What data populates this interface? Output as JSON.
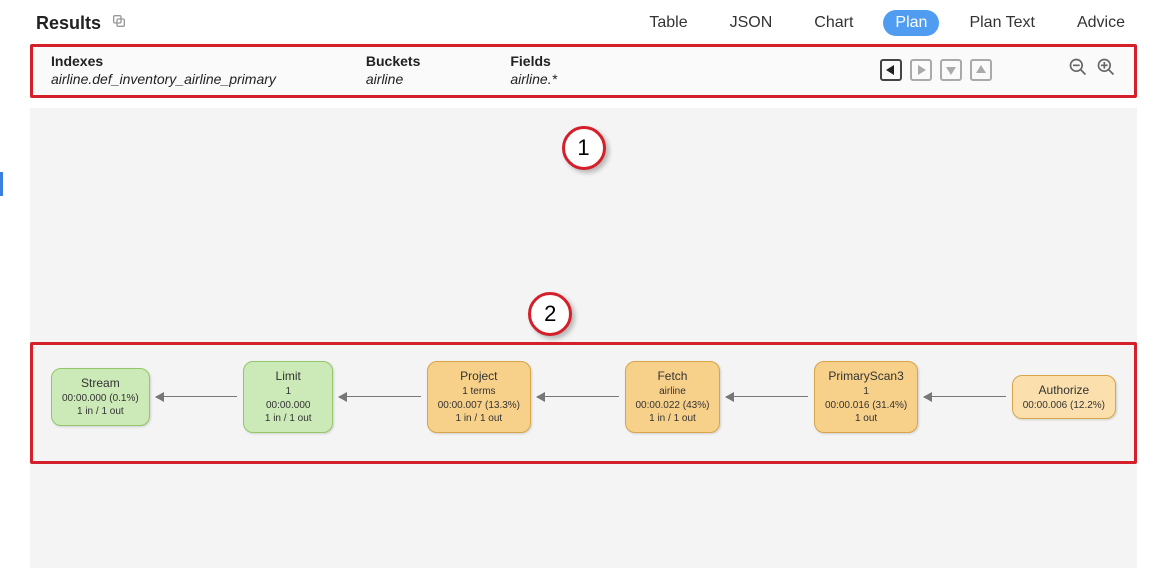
{
  "header": {
    "title": "Results"
  },
  "tabs": {
    "table": "Table",
    "json": "JSON",
    "chart": "Chart",
    "plan": "Plan",
    "plantext": "Plan Text",
    "advice": "Advice",
    "active": "plan"
  },
  "info": {
    "indexes": {
      "label": "Indexes",
      "value": "airline.def_inventory_airline_primary"
    },
    "buckets": {
      "label": "Buckets",
      "value": "airline"
    },
    "fields": {
      "label": "Fields",
      "value": "airline.*"
    }
  },
  "callouts": {
    "one": "1",
    "two": "2"
  },
  "nodes": [
    {
      "id": "stream",
      "title": "Stream",
      "lines": [
        "00:00.000 (0.1%)",
        "1 in / 1 out"
      ],
      "color": "green"
    },
    {
      "id": "limit",
      "title": "Limit",
      "lines": [
        "1",
        "00:00.000",
        "1 in / 1 out"
      ],
      "color": "green"
    },
    {
      "id": "project",
      "title": "Project",
      "lines": [
        "1 terms",
        "00:00.007 (13.3%)",
        "1 in / 1 out"
      ],
      "color": "orange"
    },
    {
      "id": "fetch",
      "title": "Fetch",
      "lines": [
        "airline",
        "00:00.022 (43%)",
        "1 in / 1 out"
      ],
      "color": "orange"
    },
    {
      "id": "primaryscan3",
      "title": "PrimaryScan3",
      "lines": [
        "1",
        "00:00.016 (31.4%)",
        "1 out"
      ],
      "color": "orange"
    },
    {
      "id": "authorize",
      "title": "Authorize",
      "lines": [
        "00:00.006 (12.2%)"
      ],
      "color": "lightorange"
    }
  ]
}
